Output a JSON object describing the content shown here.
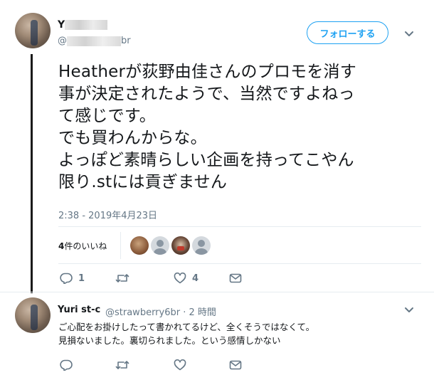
{
  "tweet": {
    "author": {
      "name_visible": "Y",
      "handle_prefix": "@",
      "handle_suffix": "br"
    },
    "follow_button": "フォローする",
    "text": "Heatherが荻野由佳さんのプロモを消す\n事が決定されたようで、当然ですよねっ\nて感じです。\nでも買わんからな。\nよっぽど素晴らしい企画を持ってこやん\n限り.stには貢ぎません",
    "timestamp": "2:38 - 2019年4月23日",
    "likes": {
      "count": "4",
      "label_suffix": "件のいいね"
    },
    "actions": {
      "reply_count": "1",
      "retweet_count": "",
      "like_count": "4"
    }
  },
  "reply": {
    "name": "Yuri st-c",
    "handle": "@strawberry6br",
    "separator": "·",
    "time": "2 時間",
    "text": "ご心配をお掛けしたって書かれてるけど、全くそうではなくて。\n見損ないました。裏切られました。という感情しかない",
    "actions": {
      "reply_count": "",
      "retweet_count": "",
      "like_count": ""
    }
  },
  "colors": {
    "accent": "#1da1f2",
    "muted": "#657786",
    "divider": "#e6ecf0"
  }
}
